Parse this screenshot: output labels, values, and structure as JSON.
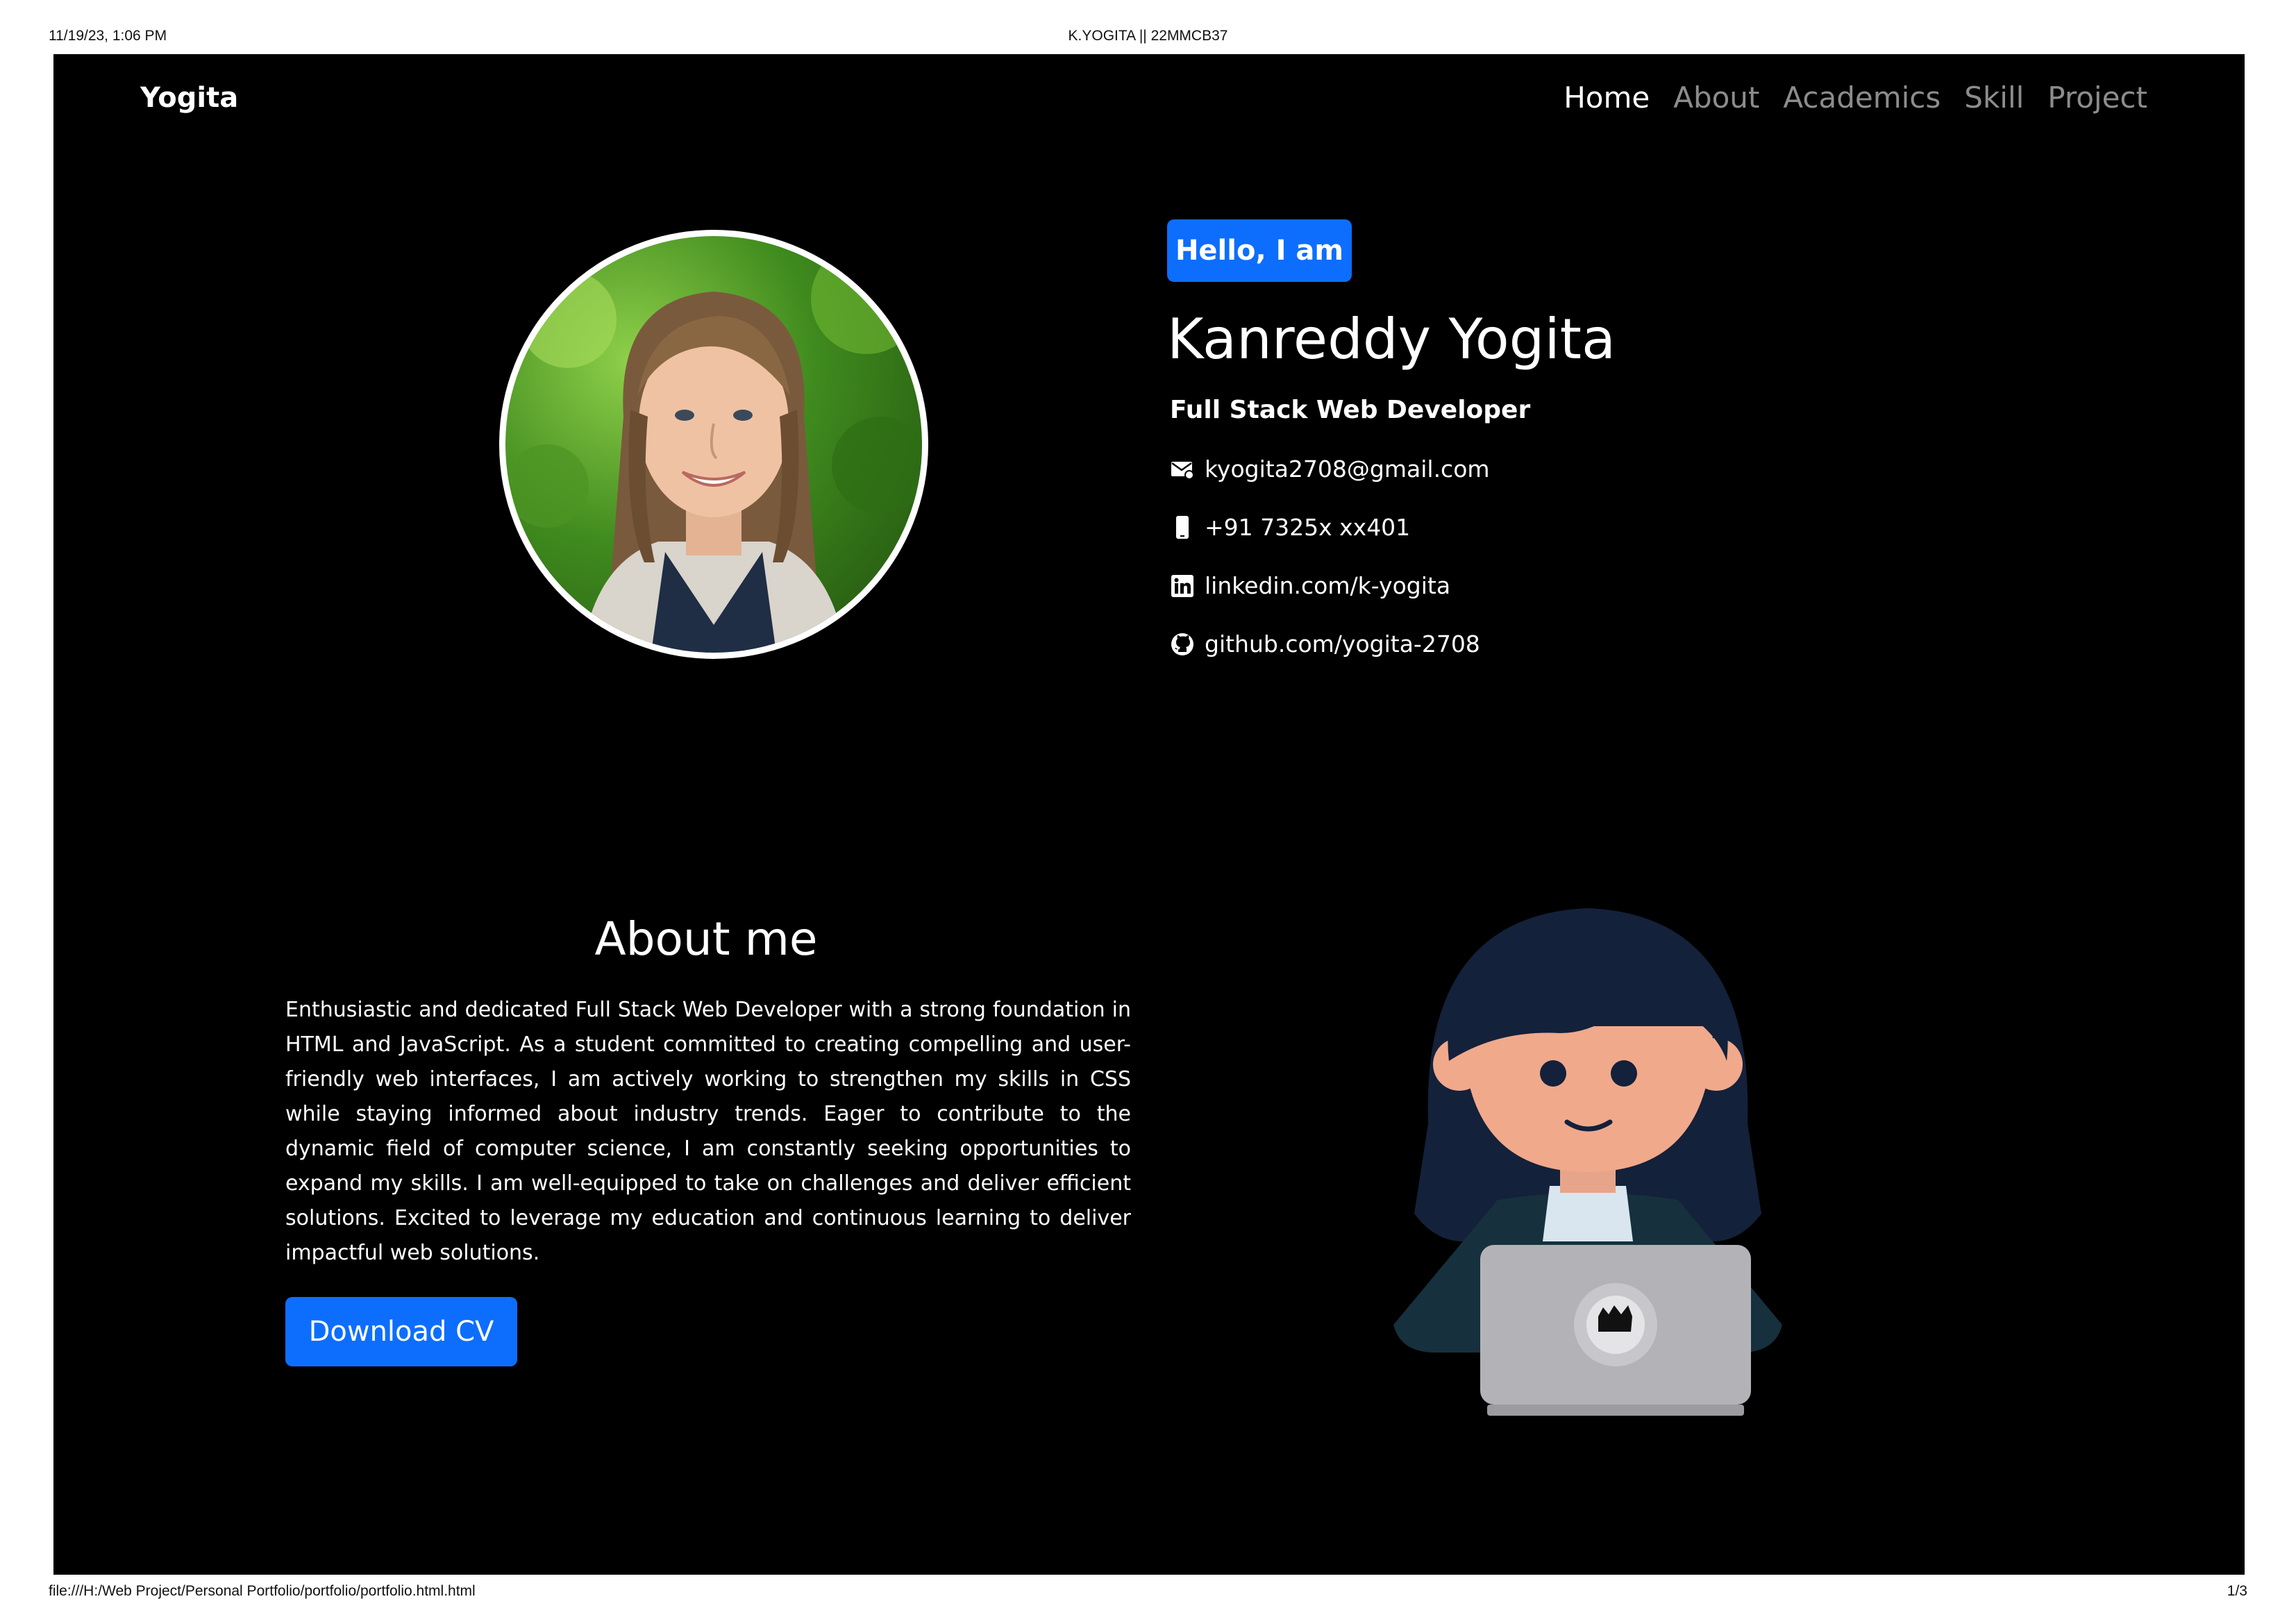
{
  "print": {
    "datetime": "11/19/23, 1:06 PM",
    "doc_title": "K.YOGITA || 22MMCB37",
    "url": "file:///H:/Web Project/Personal Portfolio/portfolio/portfolio.html.html",
    "page": "1/3"
  },
  "navbar": {
    "brand": "Yogita",
    "links": [
      "Home",
      "About",
      "Academics",
      "Skill",
      "Project"
    ],
    "active": "Home"
  },
  "hero": {
    "badge": "Hello, I am",
    "name": "Kanreddy Yogita",
    "role": "Full Stack Web Developer",
    "contacts": [
      {
        "icon": "envelope-icon",
        "text": "kyogita2708@gmail.com"
      },
      {
        "icon": "phone-icon",
        "text": "+91 7325x xx401"
      },
      {
        "icon": "linkedin-icon",
        "text": "linkedin.com/k-yogita"
      },
      {
        "icon": "github-icon",
        "text": "github.com/yogita-2708"
      }
    ]
  },
  "about": {
    "title": "About me",
    "text": "Enthusiastic and dedicated Full Stack Web Developer with a strong foundation in HTML and JavaScript. As a student committed to creating compelling and user-friendly web interfaces, I am actively working to strengthen my skills in CSS while staying informed about industry trends. Eager to contribute to the dynamic field of computer science, I am constantly seeking opportunities to expand my skills. I am well-equipped to take on challenges and deliver efficient solutions. Excited to leverage my education and continuous learning to deliver impactful web solutions.",
    "button": "Download CV"
  },
  "colors": {
    "background": "#000000",
    "accent": "#0d6efd",
    "nav_inactive": "#8c8c8c"
  }
}
